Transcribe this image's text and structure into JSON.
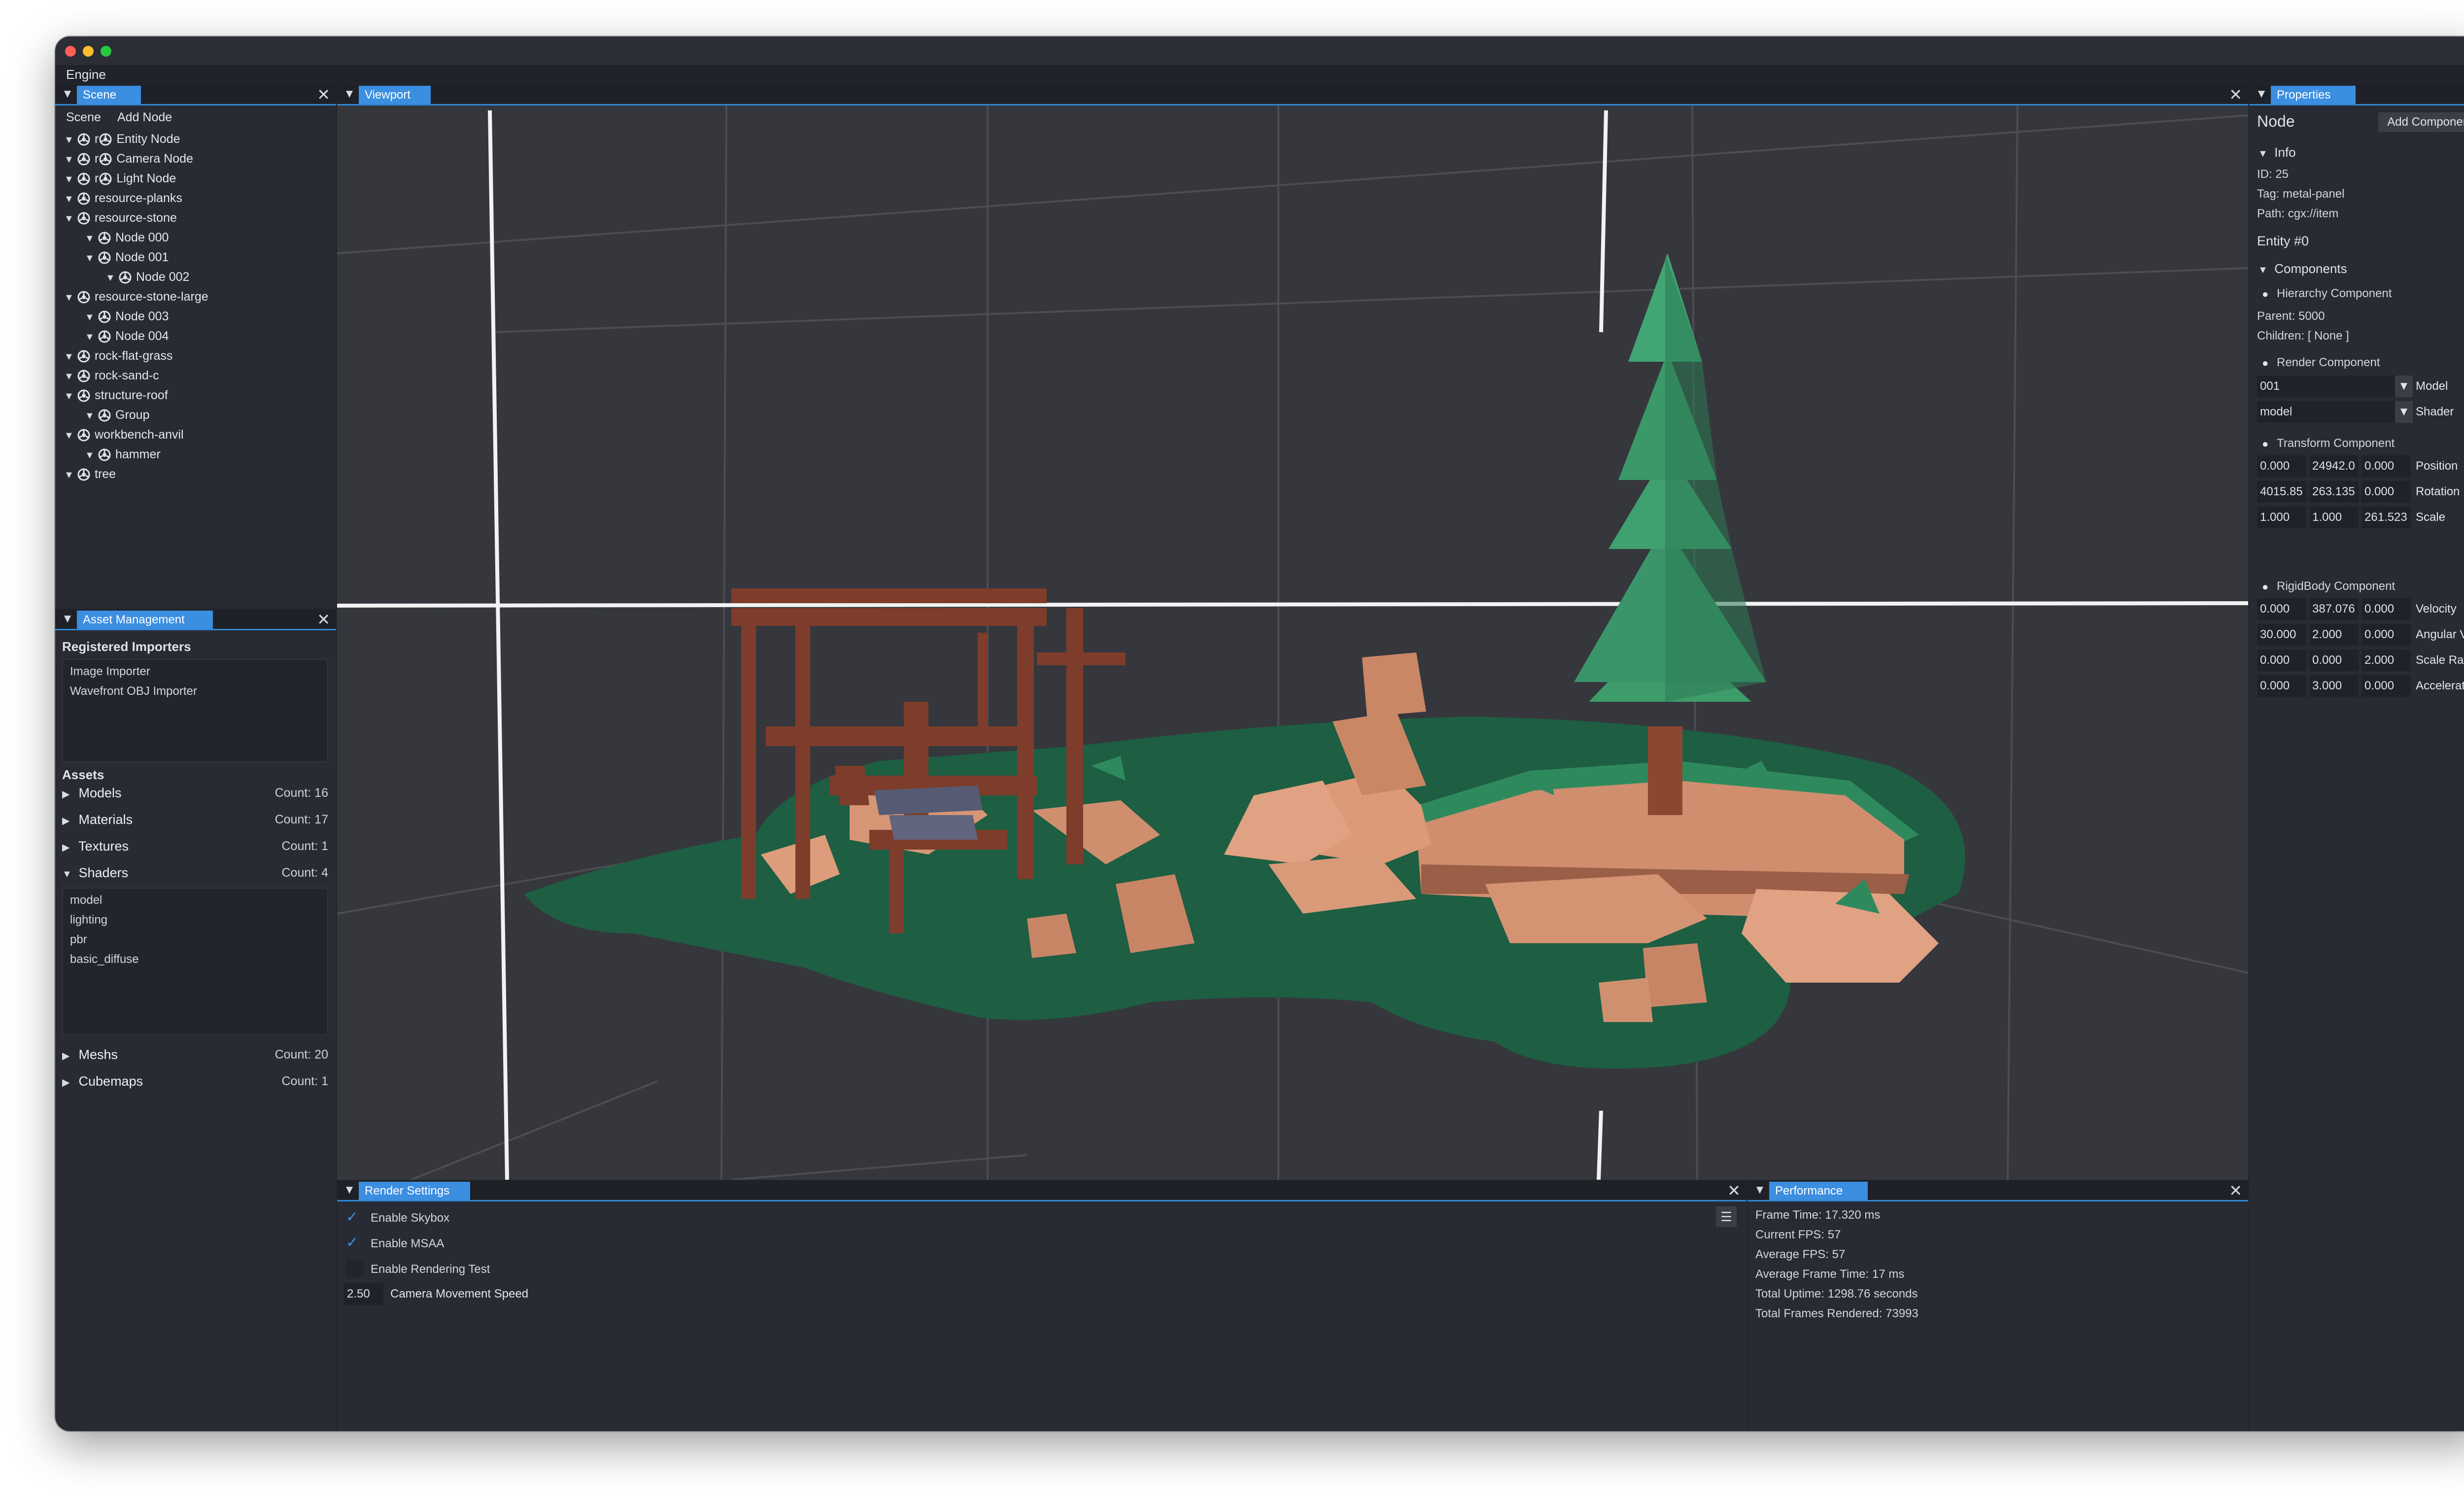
{
  "menu": {
    "engine": "Engine"
  },
  "scene_panel": {
    "tab": "Scene",
    "subtabs": [
      "Scene",
      "Add Node"
    ],
    "tree": [
      {
        "label": "Entity Node",
        "level": 0,
        "prefix": "r"
      },
      {
        "label": "Camera Node",
        "level": 0,
        "prefix": "r"
      },
      {
        "label": "Light Node",
        "level": 0,
        "prefix": "r"
      },
      {
        "label": "resource-planks",
        "level": 0
      },
      {
        "label": "resource-stone",
        "level": 0
      },
      {
        "label": "Node 000",
        "level": 1
      },
      {
        "label": "Node 001",
        "level": 1
      },
      {
        "label": "Node 002",
        "level": 2
      },
      {
        "label": "resource-stone-large",
        "level": 0
      },
      {
        "label": "Node 003",
        "level": 1
      },
      {
        "label": "Node 004",
        "level": 1
      },
      {
        "label": "rock-flat-grass",
        "level": 0
      },
      {
        "label": "rock-sand-c",
        "level": 0
      },
      {
        "label": "structure-roof",
        "level": 0
      },
      {
        "label": "Group",
        "level": 1
      },
      {
        "label": "workbench-anvil",
        "level": 0
      },
      {
        "label": "hammer",
        "level": 1
      },
      {
        "label": "tree",
        "level": 0
      }
    ]
  },
  "asset_panel": {
    "tab": "Asset Management",
    "registered_title": "Registered Importers",
    "importers": [
      "Image Importer",
      "Wavefront OBJ Importer"
    ],
    "assets_title": "Assets",
    "categories": [
      {
        "name": "Models",
        "count": "Count: 16",
        "expanded": false
      },
      {
        "name": "Materials",
        "count": "Count: 17",
        "expanded": false
      },
      {
        "name": "Textures",
        "count": "Count: 1",
        "expanded": false
      },
      {
        "name": "Shaders",
        "count": "Count: 4",
        "expanded": true
      },
      {
        "name": "Meshs",
        "count": "Count: 20",
        "expanded": false
      },
      {
        "name": "Cubemaps",
        "count": "Count: 1",
        "expanded": false
      }
    ],
    "shaders": [
      "model",
      "lighting",
      "pbr",
      "basic_diffuse"
    ]
  },
  "viewport": {
    "tab": "Viewport"
  },
  "properties_panel": {
    "tab": "Properties",
    "title": "Node",
    "add_component": "Add Component",
    "info_header": "Info",
    "id": "ID: 25",
    "tag": "Tag: metal-panel",
    "path": "Path: cgx://item",
    "entity": "Entity #0",
    "components_header": "Components",
    "hierarchy": {
      "title": "Hierarchy Component",
      "parent": "Parent:  5000",
      "children": "Children: [ None ]"
    },
    "render": {
      "title": "Render Component",
      "model_value": "001",
      "model_label": "Model",
      "shader_value": "model",
      "shader_label": "Shader"
    },
    "transform": {
      "title": "Transform Component",
      "rows": [
        {
          "values": [
            "0.000",
            "24942.0",
            "0.000"
          ],
          "label": "Position"
        },
        {
          "values": [
            "4015.85",
            "263.135",
            "0.000"
          ],
          "label": "Rotation"
        },
        {
          "values": [
            "1.000",
            "1.000",
            "261.523"
          ],
          "label": "Scale"
        }
      ]
    },
    "rigidbody": {
      "title": "RigidBody Component",
      "rows": [
        {
          "values": [
            "0.000",
            "387.076",
            "0.000"
          ],
          "label": "Velocity"
        },
        {
          "values": [
            "30.000",
            "2.000",
            "0.000"
          ],
          "label": "Angular Velocity"
        },
        {
          "values": [
            "0.000",
            "0.000",
            "2.000"
          ],
          "label": "Scale Rate"
        },
        {
          "values": [
            "0.000",
            "3.000",
            "0.000"
          ],
          "label": "Acceleration"
        }
      ]
    }
  },
  "render_settings": {
    "tab": "Render Settings",
    "options": [
      {
        "label": "Enable Skybox",
        "checked": true
      },
      {
        "label": "Enable MSAA",
        "checked": true
      },
      {
        "label": "Enable Rendering Test",
        "checked": false
      }
    ],
    "speed_value": "2.50",
    "speed_label": "Camera Movement Speed"
  },
  "performance": {
    "tab": "Performance",
    "lines": [
      "Frame Time: 17.320 ms",
      "Current FPS: 57",
      "Average FPS: 57",
      "Average Frame Time: 17 ms",
      "Total Uptime: 1298.76 seconds",
      "Total Frames Rendered: 73993"
    ]
  },
  "colors": {
    "accent": "#3b8ee0",
    "panel": "#282b33",
    "viewport": "#35373c"
  }
}
